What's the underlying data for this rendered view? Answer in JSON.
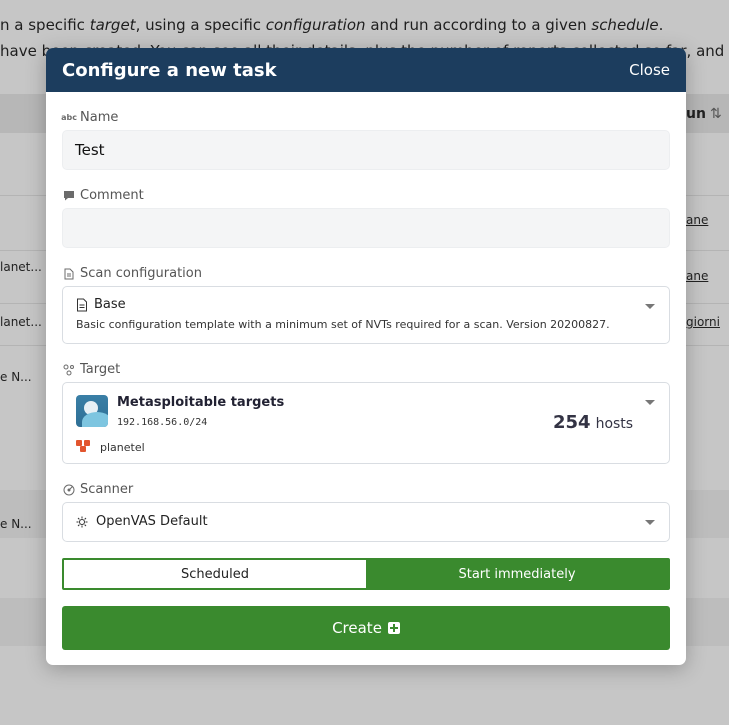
{
  "background": {
    "line1": {
      "prefix": "n a specific ",
      "target_word": "target",
      "middle": ", using a specific ",
      "configuration_word": "configuration",
      "suffix": " and run according to a given ",
      "schedule_word": "schedule",
      "end": "."
    },
    "line2": "have been created. You can see all their details, plus the number of reports collected so far, and the",
    "column_header": "un",
    "sort_glyph": "⇅",
    "left_cells": [
      "lanet...",
      "lanet...",
      "e N...",
      "e N..."
    ],
    "right_cells": [
      "ane",
      "ane",
      "giorni"
    ]
  },
  "modal": {
    "title": "Configure a new task",
    "close_label": "Close",
    "name": {
      "label": "Name",
      "value": "Test"
    },
    "comment": {
      "label": "Comment",
      "value": ""
    },
    "scan_config": {
      "label": "Scan configuration",
      "selected": "Base",
      "description": "Basic configuration template with a minimum set of NVTs required for a scan. Version 20200827."
    },
    "target": {
      "label": "Target",
      "name": "Metasploitable targets",
      "network": "192.168.56.0/24",
      "hosts_count": "254",
      "hosts_label": "hosts",
      "organization": "planetel"
    },
    "scanner": {
      "label": "Scanner",
      "selected": "OpenVAS Default"
    },
    "mode": {
      "scheduled_label": "Scheduled",
      "immediate_label": "Start immediately",
      "active": "immediate"
    },
    "create_label": "Create"
  },
  "colors": {
    "header": "#1c3d5e",
    "accent_green": "#3a8a2e",
    "org_orange": "#e2552e"
  },
  "icons": {
    "name": "text-abc-icon",
    "comment": "speech-bubble-icon",
    "scan_config": "document-icon",
    "target": "target-nodes-icon",
    "scanner": "radar-icon",
    "scanner_option": "gear-icon",
    "create": "plus-square-icon"
  }
}
